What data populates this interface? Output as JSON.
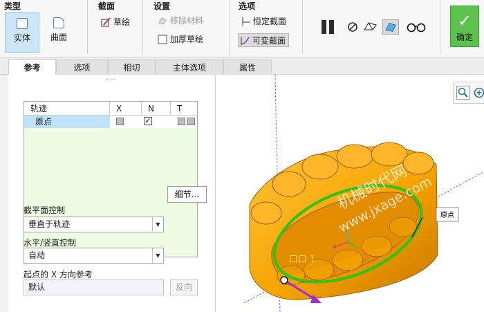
{
  "ribbon": {
    "groups": {
      "type": "类型",
      "section": "截面",
      "settings": "设置",
      "options": "选项"
    },
    "type_buttons": [
      {
        "label": "实体",
        "active": true
      },
      {
        "label": "曲面",
        "active": false
      }
    ],
    "sketch_label": "草绘",
    "remove_material_label": "移除材料",
    "thicken_sketch_label": "加厚草绘",
    "constant_section_label": "恒定截面",
    "variable_section_label": "可变截面",
    "confirm_label": "确定",
    "confirm_symbol": "✓",
    "accent": "#5bc24c"
  },
  "tabs": [
    "参考",
    "选项",
    "相切",
    "主体选项",
    "属性"
  ],
  "panel": {
    "grip": "····",
    "table": {
      "headers": [
        "轨迹",
        "X",
        "N",
        "T"
      ],
      "rows": [
        {
          "name": "原点",
          "x": "grey-box",
          "n": "checked",
          "t": "grey-boxes"
        }
      ],
      "checkmark": "✓"
    },
    "detail_button": "细节...",
    "section_plane_label": "截平面控制",
    "section_plane_value": "垂直于轨迹",
    "hv_label": "水平/竖直控制",
    "hv_value": "自动",
    "x_ref_label": "起点的 X 方向参考",
    "x_ref_value": "默认",
    "reverse_button": "反向",
    "dropdown_arrow": "▼"
  },
  "viewport": {
    "origin_label": "原点",
    "watermark_cn": "机械时代网",
    "watermark_url": "www.jxage.com",
    "annotation": "口口 1",
    "part_color": "#f5a400",
    "trajectory_color": "#2fc21d"
  }
}
